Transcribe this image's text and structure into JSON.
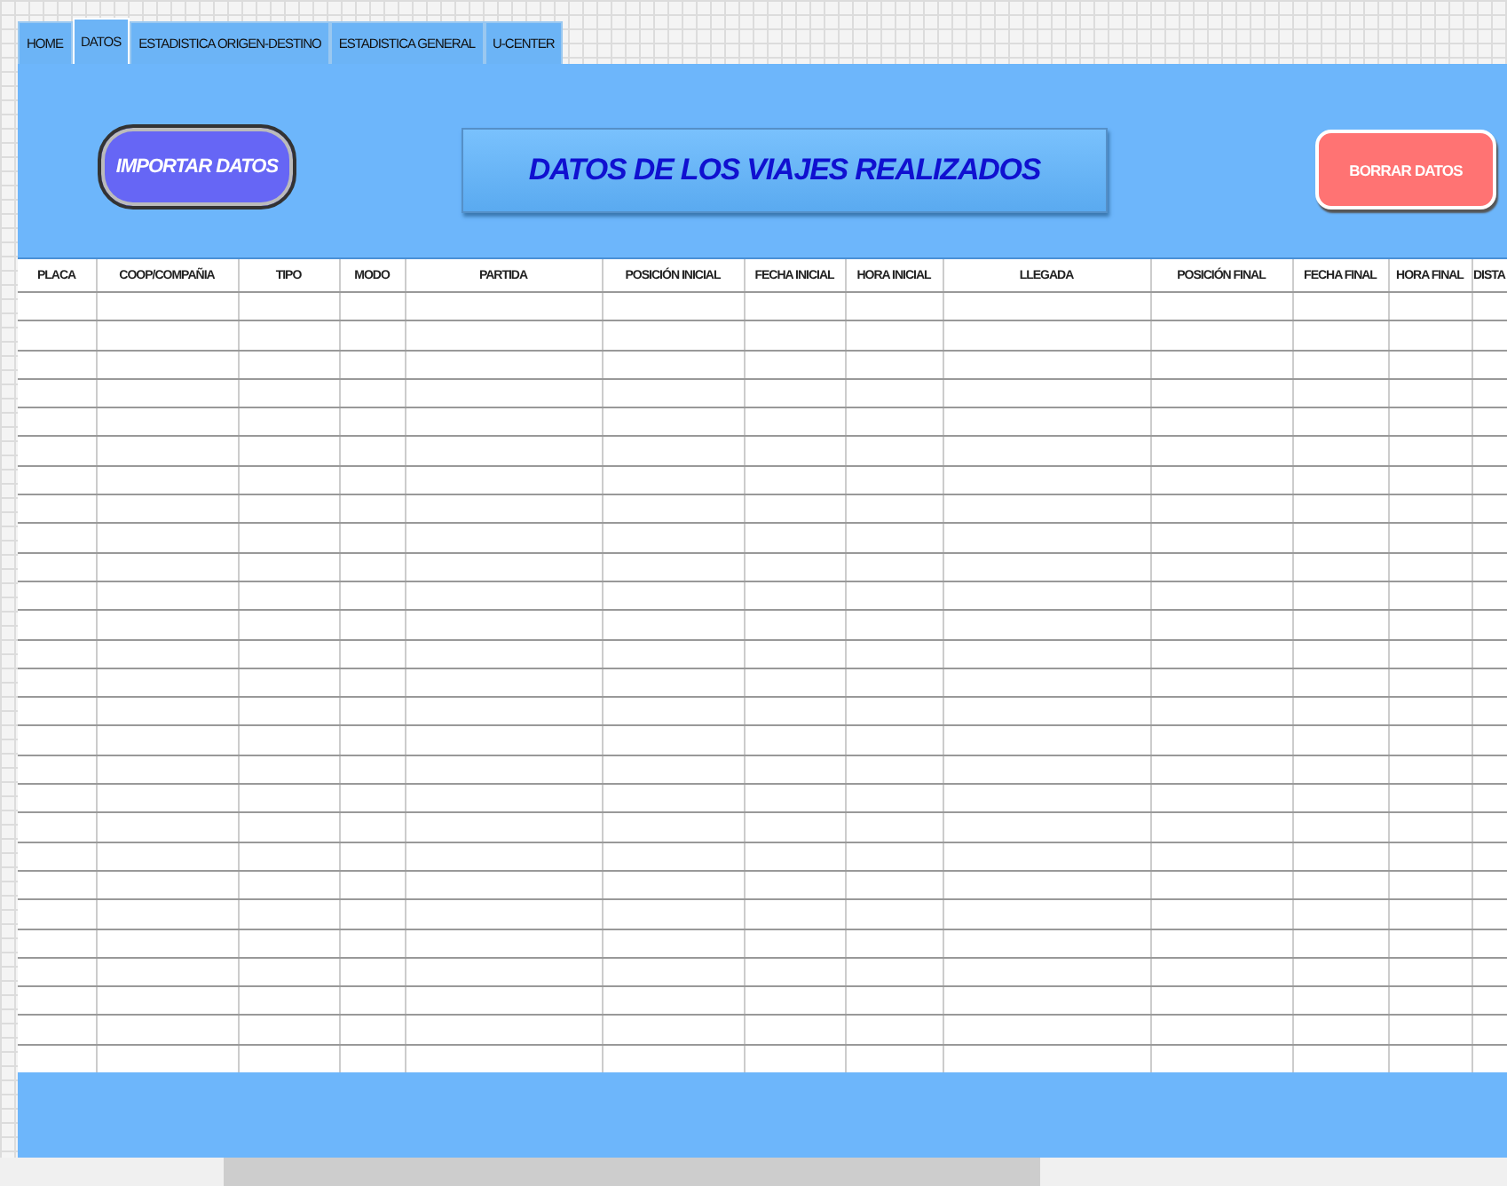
{
  "tabs": [
    {
      "label": "HOME",
      "selected": false
    },
    {
      "label": "DATOS",
      "selected": true
    },
    {
      "label": "ESTADISTICA ORIGEN-DESTINO",
      "selected": false
    },
    {
      "label": "ESTADISTICA  GENERAL",
      "selected": false
    },
    {
      "label": "U-CENTER",
      "selected": false
    }
  ],
  "import_button": "IMPORTAR DATOS",
  "title": "DATOS DE LOS VIAJES REALIZADOS",
  "clear_button": "BORRAR DATOS",
  "table": {
    "columns": [
      "PLACA",
      "COOP/COMPAÑIA",
      "TIPO",
      "MODO",
      "PARTIDA",
      "POSICIÓN INICIAL",
      "FECHA INICIAL",
      "HORA INICIAL",
      "LLEGADA",
      "POSICIÓN FINAL",
      "FECHA FINAL",
      "HORA FINAL",
      "DISTA"
    ]
  }
}
